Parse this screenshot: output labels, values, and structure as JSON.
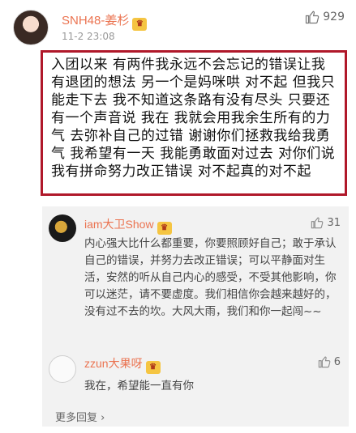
{
  "post": {
    "username": "SNH48-姜杉",
    "badge_icon": "vip-crown-icon",
    "time": "11-2 23:08",
    "likes": "929",
    "text": "入团以来 有两件我永远不会忘记的错误让我有退团的想法 另一个是妈咪哄 对不起 但我只能走下去 我不知道这条路有没有尽头 只要还有一个声音说 我在 我就会用我余生所有的力气 去弥补自己的过错 谢谢你们拯救我给我勇气 我希望有一天 我能勇敢面对过去 对你们说 我有拼命努力改正错误 对不起真的对不起"
  },
  "replies": [
    {
      "username": "iam大卫Show",
      "likes": "31",
      "text": "内心强大比什么都重要，你要照顾好自己；敢于承认自己的错误，并努力去改正错误；可以平静面对生活，安然的听从自己内心的感受，不受其他影响，你可以迷茫，请不要虚度。我们相信你会越来越好的，没有过不去的坎。大风大雨，我们和你一起闯~~"
    },
    {
      "username": "zzun大果呀",
      "likes": "6",
      "text": "我在，希望能一直有你"
    }
  ],
  "more_replies": "更多回复 ›",
  "colors": {
    "accent": "#eb7350",
    "highlight_border": "#b0182a",
    "reply_bg": "#f2f2f2"
  }
}
